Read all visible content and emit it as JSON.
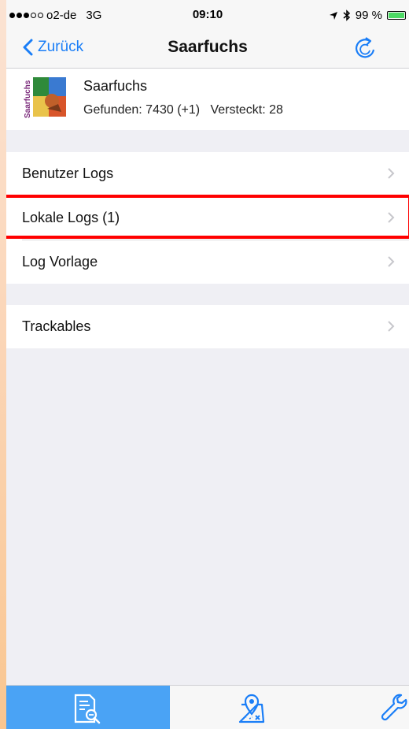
{
  "status_bar": {
    "carrier": "o2-de",
    "network": "3G",
    "time": "09:10",
    "battery": "99 %",
    "battery_level": 0.99,
    "signal_bars": 3
  },
  "nav": {
    "back_label": "Zurück",
    "title": "Saarfuchs"
  },
  "header": {
    "name": "Saarfuchs",
    "stats": "Gefunden: 7430 (+1)   Versteckt: 28",
    "logo_text": "Saarfuchs"
  },
  "groups": [
    {
      "items": [
        "Benutzer Logs",
        "Lokale Logs (1)",
        "Log Vorlage"
      ]
    },
    {
      "items": [
        "Trackables"
      ]
    }
  ],
  "tabbar": {
    "tabs": [
      "search-log-icon",
      "map-marker-icon",
      "wrench-icon"
    ],
    "active_index": 0
  },
  "colors": {
    "accent": "#1a7ef7",
    "tab_active": "#4aa3f5",
    "highlight": "#ff0000"
  }
}
